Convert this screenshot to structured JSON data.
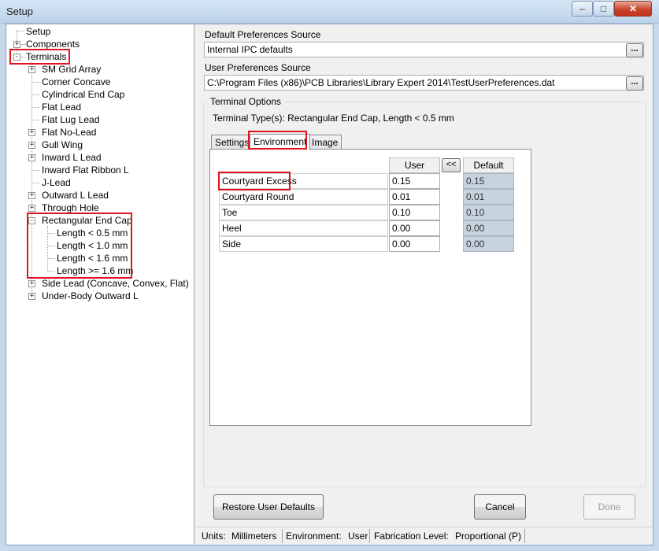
{
  "window": {
    "title": "Setup",
    "minimize": "–",
    "maximize": "□",
    "close": "✕"
  },
  "tree": {
    "setup": "Setup",
    "components": "Components",
    "terminals": "Terminals",
    "items": [
      "SM Grid Array",
      "Corner Concave",
      "Cylindrical End Cap",
      "Flat Lead",
      "Flat Lug Lead",
      "Flat No-Lead",
      "Gull Wing",
      "Inward L Lead",
      "Inward Flat Ribbon L",
      "J-Lead",
      "Outward L Lead",
      "Through Hole",
      "Rectangular End Cap"
    ],
    "rect_children": [
      "Length < 0.5 mm",
      "Length < 1.0 mm",
      "Length < 1.6 mm",
      "Length >= 1.6 mm"
    ],
    "after": [
      "Side Lead (Concave, Convex, Flat)",
      "Under-Body Outward L"
    ]
  },
  "prefs": {
    "default_label": "Default Preferences Source",
    "default_value": "Internal IPC defaults",
    "user_label": "User Preferences Source",
    "user_value": "C:\\Program Files (x86)\\PCB Libraries\\Library Expert 2014\\TestUserPreferences.dat",
    "browse": "..."
  },
  "terminal_options": {
    "title": "Terminal Options",
    "type_text": "Terminal Type(s): Rectangular End Cap, Length < 0.5 mm",
    "tabs": [
      "Settings",
      "Environment",
      "Image"
    ],
    "grid": {
      "user_header": "User",
      "copy_button": "<<",
      "default_header": "Default",
      "rows": [
        {
          "name": "Courtyard Excess",
          "user": "0.15",
          "default": "0.15"
        },
        {
          "name": "Courtyard Round",
          "user": "0.01",
          "default": "0.01"
        },
        {
          "name": "Toe",
          "user": "0.10",
          "default": "0.10"
        },
        {
          "name": "Heel",
          "user": "0.00",
          "default": "0.00"
        },
        {
          "name": "Side",
          "user": "0.00",
          "default": "0.00"
        }
      ]
    }
  },
  "buttons": {
    "restore": "Restore User Defaults",
    "cancel": "Cancel",
    "done": "Done"
  },
  "status": {
    "units_label": "Units:",
    "units_value": "Millimeters",
    "env_label": "Environment:",
    "env_value": "User",
    "fab_label": "Fabrication Level:",
    "fab_value": "Proportional (P)"
  },
  "colors": {
    "highlight": "#e0141e",
    "default_cell": "#c7d3df"
  }
}
